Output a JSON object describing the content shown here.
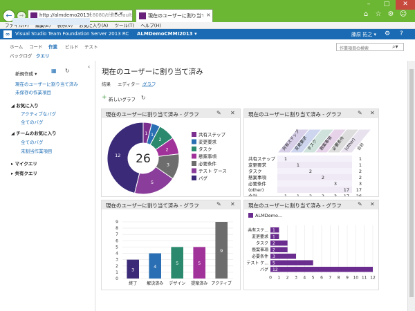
{
  "browser": {
    "url_a": "http://almdemo2013f",
    "url_b": ":8080/tfs/Default",
    "address_tools": "⌕ ▾ ✕",
    "tab_label": "現在のユーザーに割り当て済…",
    "tab_close": "×",
    "menu": [
      "ファイル(F)",
      "編集(E)",
      "表示(V)",
      "お気に入り(A)",
      "ツール(T)",
      "ヘルプ(H)"
    ]
  },
  "header": {
    "product": "Visual Studio Team Foundation Server 2013 RC",
    "project": "ALMDemoCMMI2013 ▾",
    "user": "藤原 拓之 ▾"
  },
  "hub_nav": {
    "items": [
      "ホーム",
      "コード",
      "作業",
      "ビルド",
      "テスト"
    ],
    "sub": [
      "バックログ",
      "クエリ"
    ],
    "search_placeholder": "作業項目の検索"
  },
  "left_pane": {
    "new_button": "新規作成 ▾",
    "links": [
      "現在のユーザーに割り当て済み",
      "未保存の作業項目"
    ],
    "favorites_head": "◢ お気に入り",
    "favorites": [
      "アクティブなバグ",
      "全てのバグ"
    ],
    "team_head": "◢ チームのお気に入り",
    "team": [
      "全てのバグ",
      "未割当作業項目"
    ],
    "my_queries": "▸ マイクエリ",
    "shared_queries": "▸ 共有クエリ"
  },
  "main": {
    "title": "現在のユーザーに割り当て済み",
    "tabs": [
      "結果",
      "エディター",
      "グラフ"
    ],
    "new_chart": "新しいグラフ",
    "panel_title": "現在のユーザーに割り当て済み - グラフ"
  },
  "chart_data": [
    {
      "type": "pie",
      "title": "現在のユーザーに割り当て済み - グラフ",
      "categories": [
        "共有ステップ",
        "変更要求",
        "タスク",
        "懸案事項",
        "必要条件",
        "テスト ケース",
        "バグ"
      ],
      "values": [
        1,
        1,
        2,
        2,
        3,
        5,
        12
      ],
      "colors": [
        "#7b2f8f",
        "#2a6fb3",
        "#2b8a6e",
        "#a0329a",
        "#6d6d6d",
        "#8a3d9a",
        "#3a2a78"
      ],
      "center_label": "26",
      "legend": "right"
    },
    {
      "type": "table",
      "title": "現在のユーザーに割り当て済み - グラフ",
      "columns": [
        "共有ステップ",
        "変更要求",
        "タスク",
        "懸案事項",
        "必要条件",
        "(other)",
        "合計"
      ],
      "rows": [
        {
          "label": "共有ステップ",
          "cells": [
            "1",
            "",
            "",
            "",
            "",
            "",
            "1"
          ]
        },
        {
          "label": "変更要求",
          "cells": [
            "",
            "1",
            "",
            "",
            "",
            "",
            "1"
          ]
        },
        {
          "label": "タスク",
          "cells": [
            "",
            "",
            "2",
            "",
            "",
            "",
            "2"
          ]
        },
        {
          "label": "懸案事項",
          "cells": [
            "",
            "",
            "",
            "2",
            "",
            "",
            "2"
          ]
        },
        {
          "label": "必要条件",
          "cells": [
            "",
            "",
            "",
            "",
            "3",
            "",
            "3"
          ]
        },
        {
          "label": "(other)",
          "cells": [
            "",
            "",
            "",
            "",
            "",
            "17",
            "17"
          ]
        },
        {
          "label": "合計",
          "cells": [
            "1",
            "1",
            "2",
            "2",
            "3",
            "17",
            "26"
          ]
        }
      ]
    },
    {
      "type": "bar",
      "title": "現在のユーザーに割り当て済み - グラフ",
      "categories": [
        "終了",
        "解決済み",
        "デザイン",
        "提案済み",
        "アクティブ"
      ],
      "values": [
        3,
        4,
        5,
        5,
        9
      ],
      "colors": [
        "#3a2a78",
        "#2a6fb3",
        "#2b8a6e",
        "#a0329a",
        "#6d6d6d"
      ],
      "ylim": [
        0,
        9
      ],
      "yticks": [
        "0",
        "1",
        "2",
        "3",
        "4",
        "5",
        "6",
        "7",
        "8",
        "9"
      ]
    },
    {
      "type": "bar",
      "orientation": "horizontal",
      "title": "現在のユーザーに割り当て済み - グラフ",
      "legend_label": "ALMDemo...",
      "categories": [
        "共有ステ...",
        "変更要求",
        "タスク",
        "懸案事項",
        "必要条件",
        "テスト ケ...",
        "バグ"
      ],
      "values": [
        1,
        1,
        2,
        2,
        3,
        5,
        12
      ],
      "color": "#6a2c8f",
      "xlim": [
        0,
        12
      ],
      "xticks": [
        "0",
        "1",
        "2",
        "3",
        "4",
        "5",
        "6",
        "7",
        "8",
        "9",
        "10",
        "11",
        "12"
      ]
    }
  ]
}
